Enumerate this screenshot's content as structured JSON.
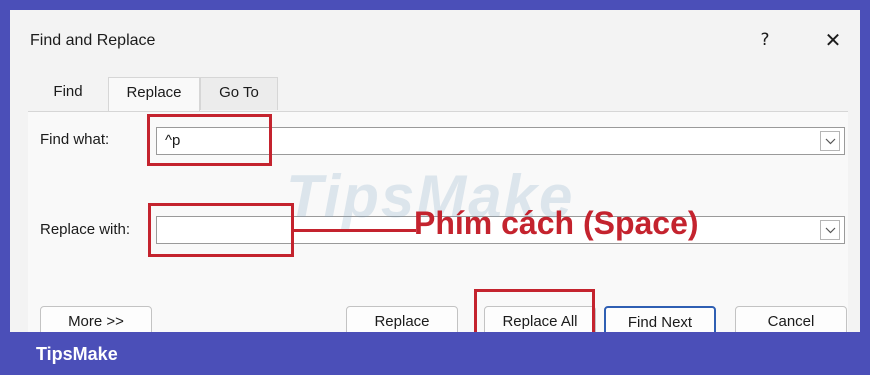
{
  "dialog": {
    "title": "Find and Replace",
    "help_label": "?",
    "close_label": "✕"
  },
  "tabs": [
    {
      "label": "Find"
    },
    {
      "label": "Replace"
    },
    {
      "label": "Go To"
    }
  ],
  "fields": {
    "find_label": "Find what:",
    "find_value": "^p",
    "replace_label": "Replace with:",
    "replace_value": ""
  },
  "buttons": {
    "more": "More >>",
    "replace": "Replace",
    "replace_all": "Replace All",
    "find_next": "Find Next",
    "cancel": "Cancel"
  },
  "annotation": "Phím cách (Space)",
  "watermark": "TipsMake",
  "footer": {
    "brand": "TipsMake"
  },
  "colors": {
    "highlight": "#c4232e",
    "background": "#4b4fb8",
    "default_button_border": "#2f5fb3"
  }
}
